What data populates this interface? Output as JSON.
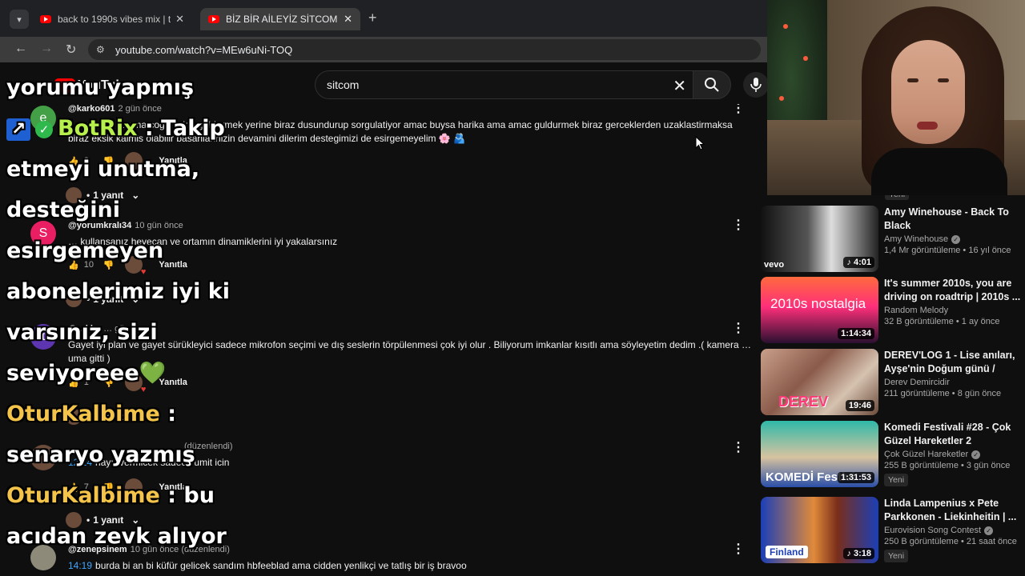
{
  "browser": {
    "tabs": [
      {
        "title": "back to 1990s vibes mix | throw"
      },
      {
        "title": "BİZ BİR AİLEYİZ SİTCOM - 1.BÖ"
      }
    ],
    "url": "youtube.com/watch?v=MEw6uNi-TOQ"
  },
  "youtube": {
    "logo_text": "YouTube",
    "search_value": "sitcom"
  },
  "comments": [
    {
      "avatar_letter": "e",
      "avatar_color": "#43a047",
      "handle": "@karko601",
      "time": "2 gün önce",
      "text": "…ş sitcom … ama cogunlukla guldurmek yerine biraz dusundurup sorgulatiyor amac buysa harika ama amac guldurmek biraz gerceklerden uzaklastirmaksa biraz eksik kalmis olabilir basarilarinizin devamini dilerim destegimizi de esirgemeyelim 🌸 🫂",
      "likes": "2",
      "reply_label": "Yanıtla",
      "replies_label": "1 yanıt"
    },
    {
      "avatar_letter": "S",
      "avatar_color": "#e91e63",
      "handle": "@yorumkralı34",
      "time": "10 gün önce",
      "text": "… kullansanız heyecan ve ortamın dinamiklerini iyi yakalarsınız",
      "likes": "10",
      "reply_label": "Yanıtla",
      "replies_label": "1 yanıt"
    },
    {
      "avatar_letter": "t",
      "avatar_color": "#5e35b1",
      "handle": "@…kky",
      "time": "… gün önce",
      "text": "Gayet iyi plan ve gayet sürükleyici sadece mikrofon seçimi ve dış seslerin törpülenmesi çok iyi olur . Biliyorum imkanlar kısıtlı ama söyleyetim dedim .( kamera … uma gitti )",
      "likes": "1",
      "reply_label": "Yanıtla",
      "replies_label": "1 yanıt"
    },
    {
      "avatar_letter": "",
      "avatar_color": "#6b4b3a",
      "handle": "",
      "time": "(düzenlendi)",
      "timestamp": "12:24",
      "text": "hayır vermicek sadece umit icin",
      "likes": "7",
      "reply_label": "Yanıtla",
      "replies_label": "1 yanıt"
    },
    {
      "avatar_letter": "",
      "avatar_color": "#8d8a7a",
      "handle": "@zenepsinem",
      "time": "10 gün önce (düzenlendi)",
      "timestamp": "14:19",
      "text": "burda bi an bi küfür gelicek sandım hbfeeblad ama cidden yenlikçi ve tatlış bir iş bravoo"
    }
  ],
  "overlay": {
    "l1": "yorumu yapmış",
    "l2_name": "BotRix",
    "l2_rest": ": Takip",
    "l3": "etmeyi unutma,",
    "l4": "desteğini",
    "l5": "esirgemeyen",
    "l6": "abonelerimiz iyi ki",
    "l7": "varsınız, sizi",
    "l8": "seviyoreee",
    "l8_emoji": "💚",
    "l9_name": "OturKalbime",
    "l9_rest": ":",
    "l10": "senaryo yazmış",
    "l11_name": "OturKalbime",
    "l11_rest": ": bu",
    "l12": "acıdan zevk alıyor"
  },
  "sidebar": {
    "top_badge": "Yeni",
    "videos": [
      {
        "title": "Amy Winehouse - Back To Black",
        "channel": "Amy Winehouse",
        "verified": true,
        "stats": "1,4 Mr görüntüleme • 16 yıl önce",
        "duration": "4:01",
        "thumb_text": "vevo",
        "badge": ""
      },
      {
        "title": "It's summer 2010s, you are driving on roadtrip | 2010s ...",
        "channel": "Random Melody",
        "verified": false,
        "stats": "32 B görüntüleme • 1 ay önce",
        "duration": "1:14:34",
        "thumb_text": "2010s nostalgia",
        "badge": ""
      },
      {
        "title": "DEREV'LOG 1 - Lise anıları, Ayşe'nin Doğum günü / Erasm...",
        "channel": "Derev Demircidir",
        "verified": false,
        "stats": "211 görüntüleme • 8 gün önce",
        "duration": "19:46",
        "thumb_text": "DEREV",
        "badge": ""
      },
      {
        "title": "Komedi Festivali #28 - Çok Güzel Hareketler 2",
        "channel": "Çok Güzel Hareketler",
        "verified": true,
        "stats": "255 B görüntüleme • 3 gün önce",
        "duration": "1:31:53",
        "thumb_text": "KOMEDİ Festivi",
        "badge": "Yeni"
      },
      {
        "title": "Linda Lampenius x Pete Parkkonen - Liekinheitin | ...",
        "channel": "Eurovision Song Contest",
        "verified": true,
        "stats": "250 B görüntüleme • 21 saat önce",
        "duration": "3:18",
        "thumb_text": "Finland",
        "badge": "Yeni"
      }
    ]
  }
}
